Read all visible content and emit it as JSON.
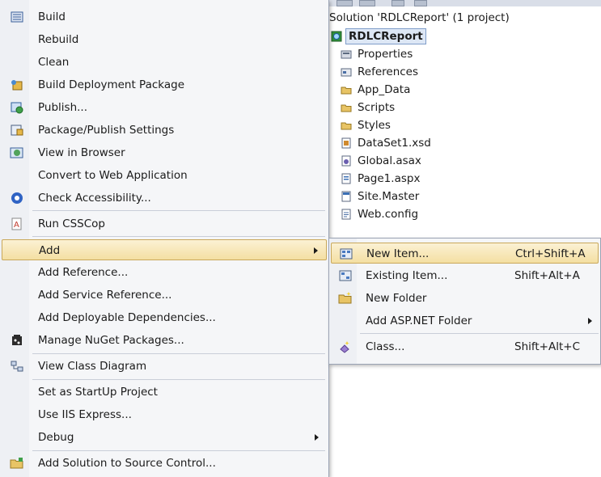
{
  "solution_explorer": {
    "title": "Solution 'RDLCReport' (1 project)",
    "project": "RDLCReport",
    "items": [
      {
        "label": "Properties",
        "icon": "properties-icon"
      },
      {
        "label": "References",
        "icon": "references-icon"
      },
      {
        "label": "App_Data",
        "icon": "folder-icon"
      },
      {
        "label": "Scripts",
        "icon": "folder-icon"
      },
      {
        "label": "Styles",
        "icon": "folder-icon"
      },
      {
        "label": "DataSet1.xsd",
        "icon": "dataset-file-icon"
      },
      {
        "label": "Global.asax",
        "icon": "global-asax-icon"
      },
      {
        "label": "Page1.aspx",
        "icon": "aspx-page-icon"
      },
      {
        "label": "Site.Master",
        "icon": "master-page-icon"
      },
      {
        "label": "Web.config",
        "icon": "config-file-icon"
      }
    ]
  },
  "context_menu": {
    "items": [
      {
        "label": "Build",
        "icon": "build-icon"
      },
      {
        "label": "Rebuild",
        "icon": ""
      },
      {
        "label": "Clean",
        "icon": ""
      },
      {
        "label": "Build Deployment Package",
        "icon": "deployment-package-icon"
      },
      {
        "label": "Publish...",
        "icon": "publish-icon"
      },
      {
        "label": "Package/Publish Settings",
        "icon": "package-settings-icon"
      },
      {
        "label": "View in Browser",
        "icon": "view-in-browser-icon"
      },
      {
        "label": "Convert to Web Application",
        "icon": ""
      },
      {
        "label": "Check Accessibility...",
        "icon": "accessibility-icon"
      },
      {
        "label": "Run CSSCop",
        "icon": "csscop-icon"
      },
      {
        "label": "Add",
        "icon": "",
        "submenu": true,
        "highlighted": true
      },
      {
        "label": "Add Reference...",
        "icon": ""
      },
      {
        "label": "Add Service Reference...",
        "icon": ""
      },
      {
        "label": "Add Deployable Dependencies...",
        "icon": ""
      },
      {
        "label": "Manage NuGet Packages...",
        "icon": "nuget-icon"
      },
      {
        "label": "View Class Diagram",
        "icon": "class-diagram-icon"
      },
      {
        "label": "Set as StartUp Project",
        "icon": ""
      },
      {
        "label": "Use IIS Express...",
        "icon": ""
      },
      {
        "label": "Debug",
        "icon": "",
        "submenu": true
      },
      {
        "label": "Add Solution to Source Control...",
        "icon": "source-control-icon"
      }
    ]
  },
  "add_submenu": {
    "items": [
      {
        "label": "New Item...",
        "shortcut": "Ctrl+Shift+A",
        "icon": "new-item-icon",
        "highlighted": true
      },
      {
        "label": "Existing Item...",
        "shortcut": "Shift+Alt+A",
        "icon": "existing-item-icon"
      },
      {
        "label": "New Folder",
        "shortcut": "",
        "icon": "new-folder-icon"
      },
      {
        "label": "Add ASP.NET Folder",
        "shortcut": "",
        "icon": "",
        "submenu": true
      },
      {
        "label": "Class...",
        "shortcut": "Shift+Alt+C",
        "icon": "class-icon"
      }
    ]
  }
}
